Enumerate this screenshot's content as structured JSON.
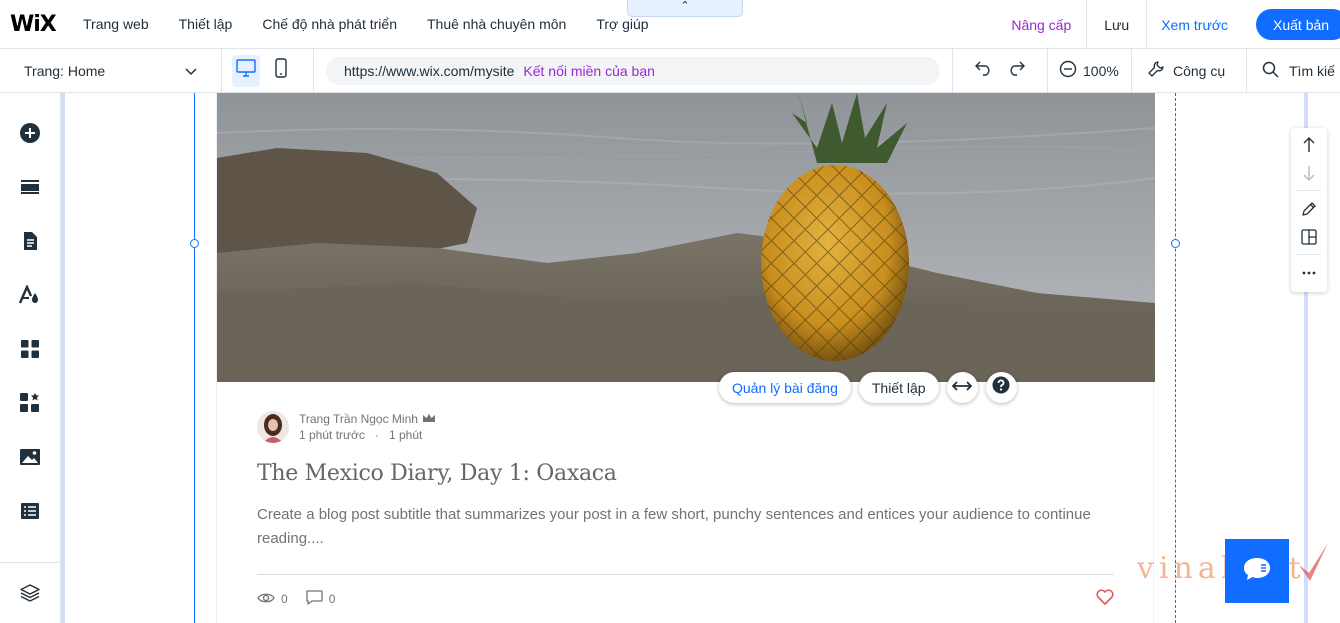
{
  "topbar": {
    "logo": "WiX",
    "nav": [
      "Trang web",
      "Thiết lập",
      "Chế độ nhà phát triển",
      "Thuê nhà chuyên môn",
      "Trợ giúp"
    ],
    "collapse_glyph": "⌃",
    "upgrade_label": "Nâng cấp",
    "save_label": "Lưu",
    "preview_label": "Xem trước",
    "publish_label": "Xuất bản"
  },
  "toolbar2": {
    "page_label": "Trang: Home",
    "url": "https://www.wix.com/mysite",
    "connect_domain": "Kết nối miền của bạn",
    "zoom": "100%",
    "tools_label": "Công cụ",
    "search_label": "Tìm kiế"
  },
  "sidebar": {
    "items": [
      "add-elements-icon",
      "add-section-icon",
      "pages-icon",
      "design-icon",
      "apps-icon",
      "business-apps-icon",
      "media-icon",
      "cms-icon",
      "layers-icon"
    ]
  },
  "post": {
    "author": "Trang Trần Ngọc Minh",
    "time_ago": "1 phút trước",
    "read_time": "1 phút",
    "title": "The Mexico Diary, Day 1: Oaxaca",
    "excerpt": "Create a blog post subtitle that summarizes your post in a few short, punchy sentences and entices your audience to continue reading....",
    "views": "0",
    "comments": "0"
  },
  "element_actions": {
    "manage_posts": "Quản lý bài đăng",
    "settings": "Thiết lập"
  },
  "watermark": "vinahost",
  "colors": {
    "accent": "#116dff",
    "upgrade": "#9a27d5",
    "like": "#e05b5b"
  }
}
